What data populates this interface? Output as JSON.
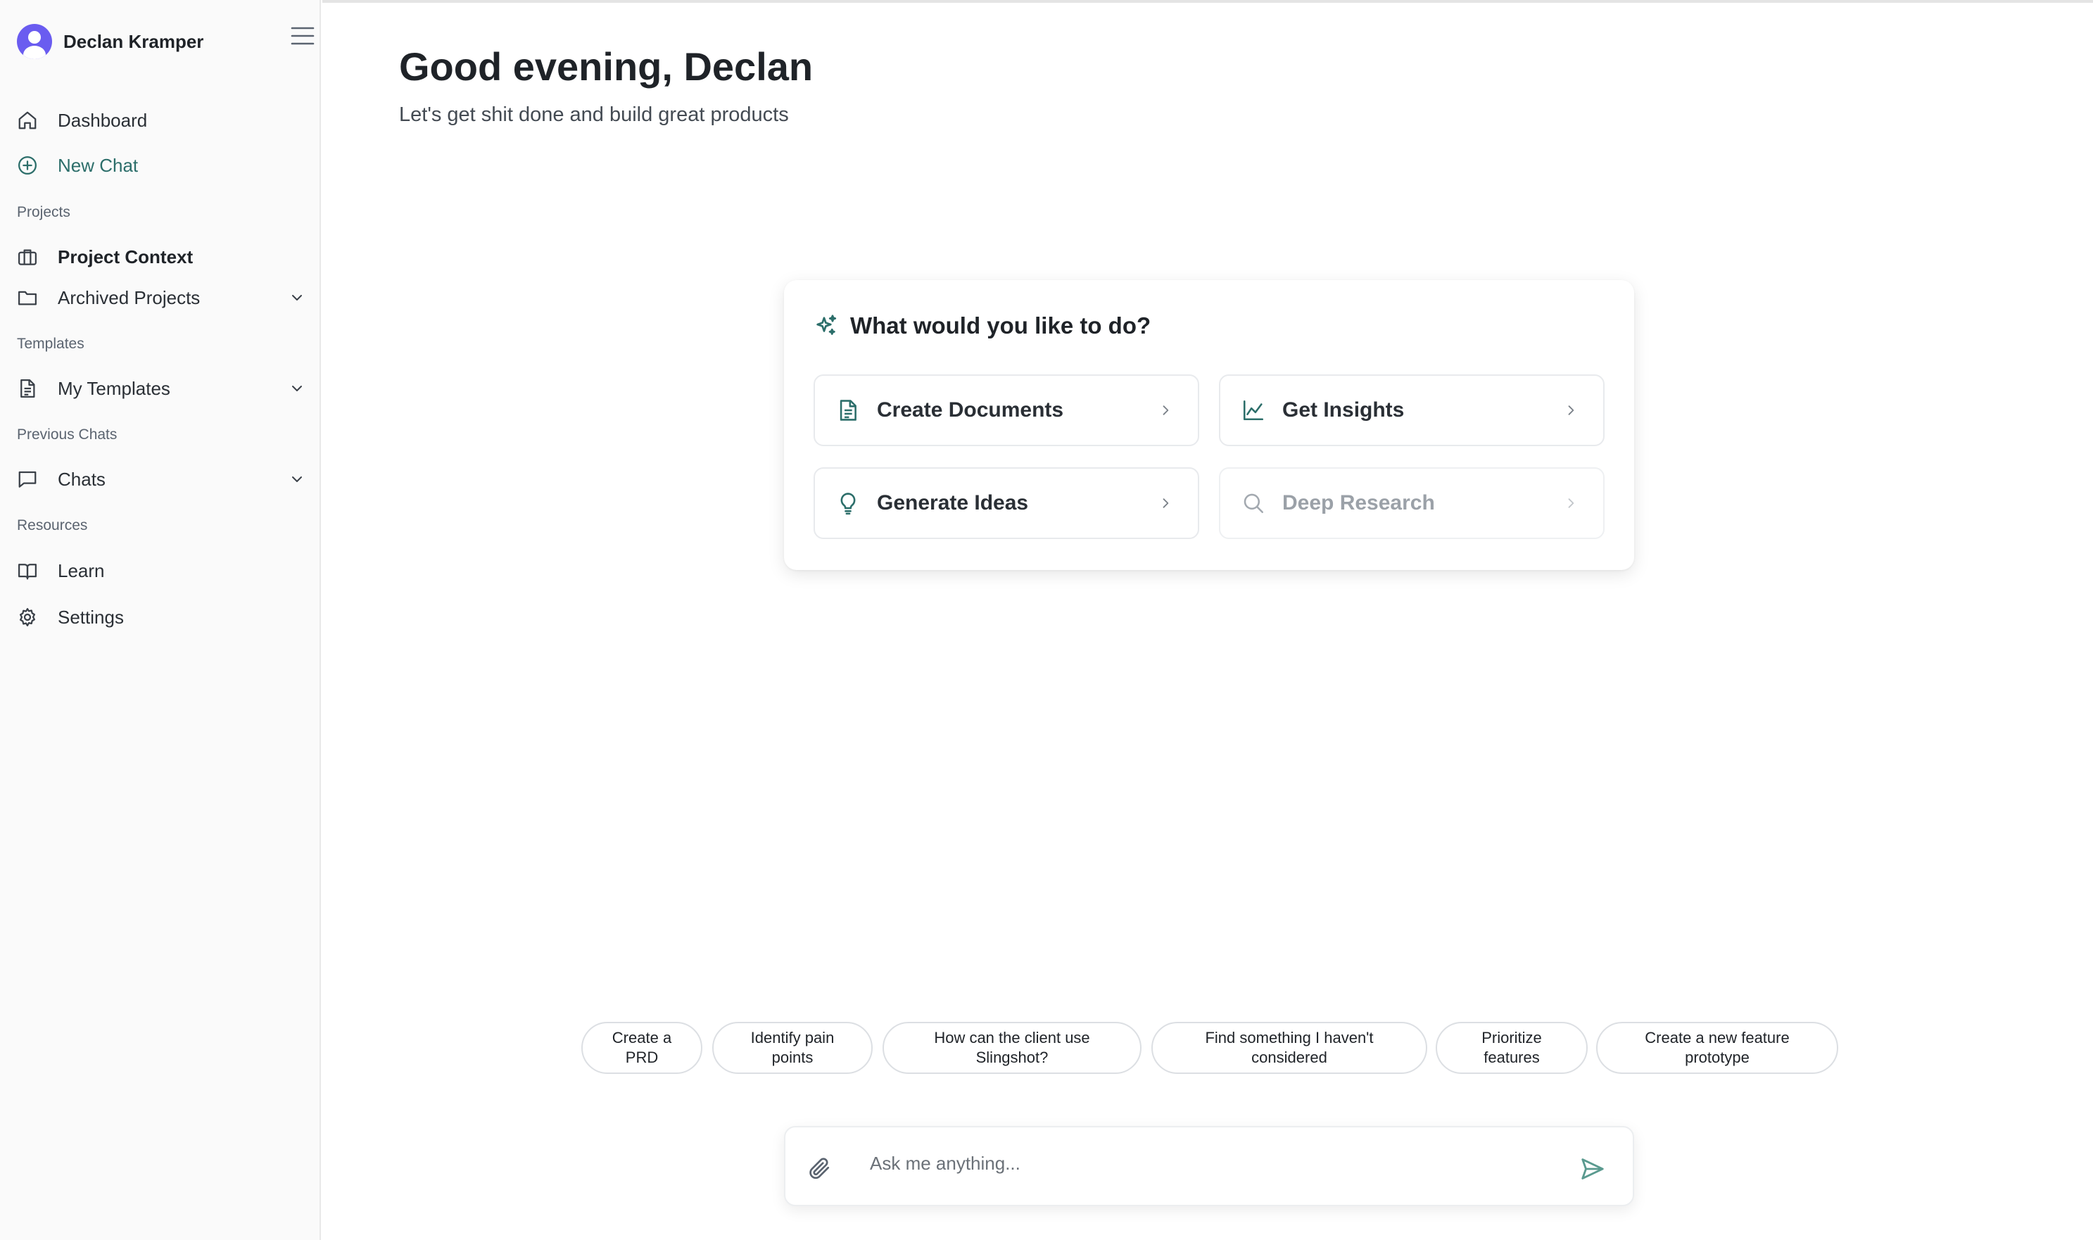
{
  "user": {
    "name": "Declan Kramper"
  },
  "sidebar": {
    "dashboard": "Dashboard",
    "new_chat": "New Chat",
    "sections": {
      "projects": "Projects",
      "templates": "Templates",
      "previous_chats": "Previous Chats",
      "resources": "Resources"
    },
    "project_context": "Project Context",
    "archived_projects": "Archived Projects",
    "my_templates": "My Templates",
    "chats": "Chats",
    "learn": "Learn",
    "settings": "Settings"
  },
  "main": {
    "greeting": "Good evening, Declan",
    "subtitle": "Let's get shit done and build great products",
    "card": {
      "title": "What would you like to do?",
      "actions": [
        {
          "label": "Create Documents",
          "icon": "document-icon"
        },
        {
          "label": "Get Insights",
          "icon": "chart-line-icon"
        },
        {
          "label": "Generate Ideas",
          "icon": "lightbulb-icon"
        },
        {
          "label": "Deep Research",
          "icon": "search-icon",
          "disabled": true
        }
      ]
    },
    "suggestions": [
      "Create a PRD",
      "Identify pain points",
      "How can the client use Slingshot?",
      "Find something I haven't considered",
      "Prioritize features",
      "Create a new feature prototype"
    ],
    "composer": {
      "placeholder": "Ask me anything..."
    }
  },
  "colors": {
    "accent": "#2c6e6a",
    "avatar": "#6a5cf0",
    "sidebar_bg": "#fafafa"
  }
}
